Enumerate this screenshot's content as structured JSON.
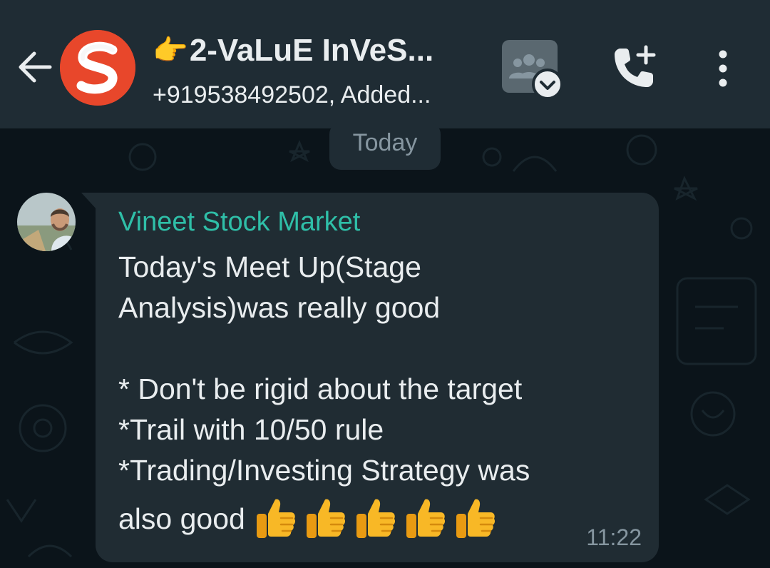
{
  "header": {
    "back_icon": "arrow-left-icon",
    "title_emoji": "👉",
    "title": "2-VaLuE InVeS...",
    "subtitle": "+919538492502, Added...",
    "community_icon": "community-icon",
    "call_icon": "add-call-icon",
    "menu_icon": "more-vert-icon"
  },
  "chat": {
    "date_label": "Today",
    "message": {
      "sender": "Vineet Stock Market",
      "text": "Today's Meet Up(Stage\nAnalysis)was really good\n\n* Don't be rigid about the target\n*Trail with 10/50 rule\n*Trading/Investing Strategy was",
      "last_line": "also good",
      "emoji": "👍👍👍👍👍",
      "time": "11:22"
    }
  },
  "colors": {
    "header_bg": "#1f2c34",
    "chat_bg": "#0b141a",
    "bubble_bg": "#202c33",
    "sender_name": "#2fbfa8",
    "text_primary": "#e9edef",
    "text_secondary": "#8696a0",
    "logo_red": "#e8472b"
  }
}
